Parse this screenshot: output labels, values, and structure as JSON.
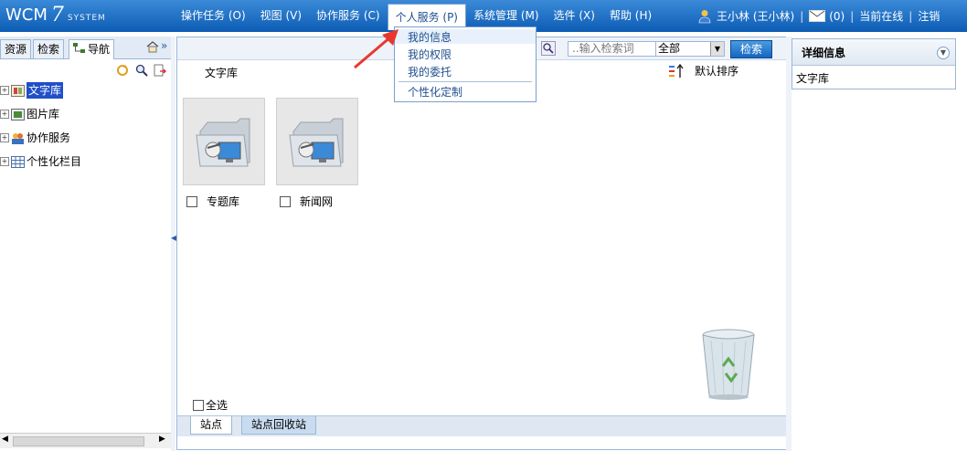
{
  "app": {
    "logo_text": "WCM",
    "logo_version": "7",
    "logo_sub": "SYSTEM"
  },
  "menu": [
    {
      "label": "操作任务 (O)"
    },
    {
      "label": "视图 (V)"
    },
    {
      "label": "协作服务 (C)"
    },
    {
      "label": "个人服务 (P)"
    },
    {
      "label": "系统管理 (M)"
    },
    {
      "label": "选件 (X)"
    },
    {
      "label": "帮助 (H)"
    }
  ],
  "user": {
    "name": "王小林 (王小林)",
    "messages": "(0)",
    "online": "当前在线",
    "logout": "注销"
  },
  "dropdown": {
    "items": [
      {
        "label": "我的信息"
      },
      {
        "label": "我的权限"
      },
      {
        "label": "我的委托"
      },
      {
        "label": "个性化定制"
      }
    ]
  },
  "left": {
    "tabs": [
      {
        "label": "资源"
      },
      {
        "label": "检索"
      },
      {
        "label": "导航"
      }
    ],
    "tree": [
      {
        "label": "文字库"
      },
      {
        "label": "图片库"
      },
      {
        "label": "协作服务"
      },
      {
        "label": "个性化栏目"
      }
    ]
  },
  "main": {
    "search_placeholder": "..输入检索词",
    "search_scope": "全部",
    "search_button": "检索",
    "breadcrumb": "文字库",
    "sort_label": "默认排序",
    "items": [
      {
        "label": "专题库"
      },
      {
        "label": "新闻网"
      }
    ],
    "select_all": "全选",
    "bottom_tabs": [
      {
        "label": "站点"
      },
      {
        "label": "站点回收站"
      }
    ]
  },
  "right": {
    "title": "详细信息",
    "value": "文字库"
  },
  "colors": {
    "topbar": "#1565c0",
    "highlight": "#2050c8",
    "arrow": "#e8382e"
  }
}
